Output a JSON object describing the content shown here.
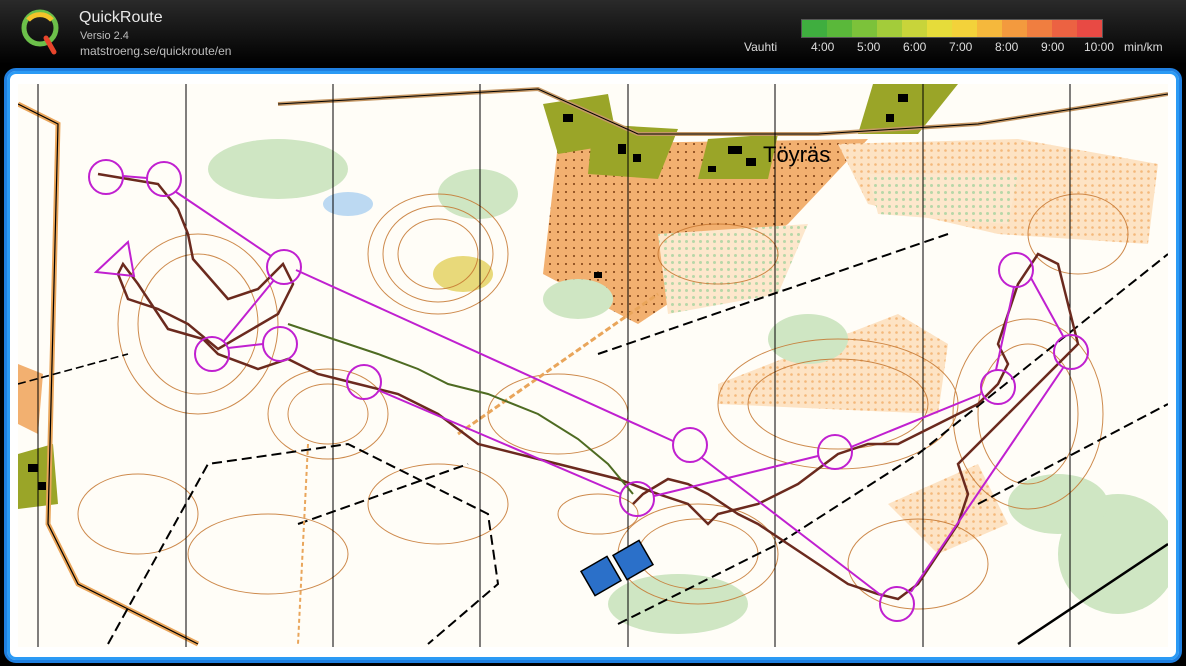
{
  "app": {
    "title": "QuickRoute",
    "version": "Versio 2.4",
    "url": "matstroeng.se/quickroute/en"
  },
  "legend": {
    "label": "Vauhti",
    "ticks": [
      "4:00",
      "5:00",
      "6:00",
      "7:00",
      "8:00",
      "9:00",
      "10:00"
    ],
    "unit": "min/km",
    "colors": [
      "#3fae3f",
      "#5ab83a",
      "#7cc23a",
      "#a3cc3a",
      "#c8d43a",
      "#e6dc3a",
      "#f3d23a",
      "#f5b83c",
      "#f39a3e",
      "#f07e40",
      "#ec6242",
      "#e84a44"
    ]
  },
  "map": {
    "place_name": "Töyräs",
    "course_color": "#c020d0",
    "route_color": "#6b2a1e"
  }
}
